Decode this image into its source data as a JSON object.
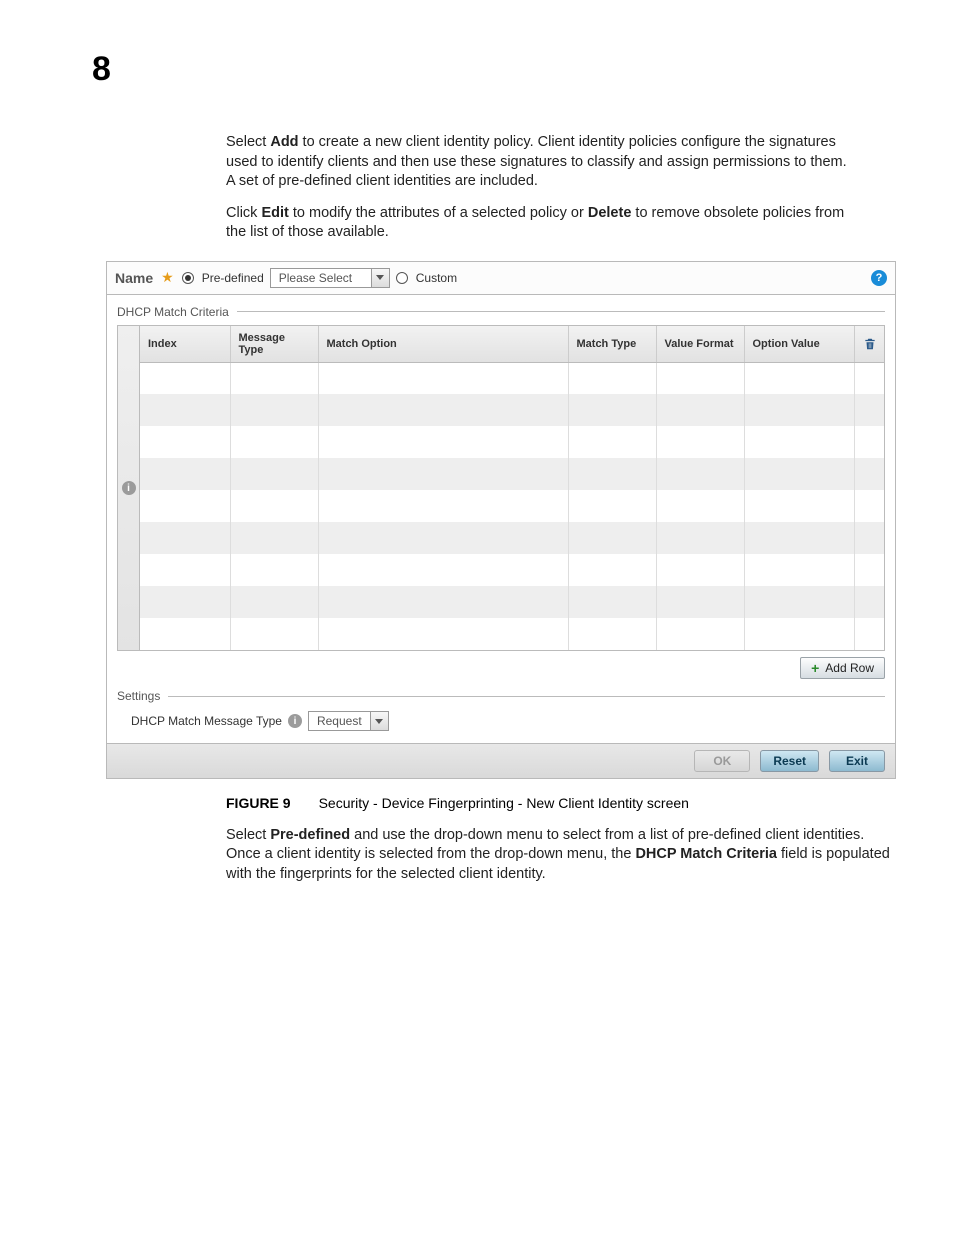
{
  "page": {
    "chapter_number": "8"
  },
  "intro": {
    "p1_a": "Select ",
    "p1_bold1": "Add",
    "p1_b": " to create a new client identity policy. Client identity policies configure the signatures used to identify clients and then use these signatures to classify and assign permissions to them. A set of pre-defined client identities are included.",
    "p2_a": "Click ",
    "p2_bold1": "Edit",
    "p2_b": " to modify the attributes of a selected policy or ",
    "p2_bold2": "Delete",
    "p2_c": " to remove obsolete policies from the list of those available."
  },
  "panel": {
    "name_label": "Name",
    "radio_predefined": "Pre-defined",
    "select_placeholder": "Please Select",
    "radio_custom": "Custom",
    "help_symbol": "?",
    "criteria_title": "DHCP Match Criteria",
    "columns": {
      "index": "Index",
      "message_type": "Message Type",
      "match_option": "Match Option",
      "match_type": "Match Type",
      "value_format": "Value Format",
      "option_value": "Option Value"
    },
    "info_symbol": "i",
    "add_row": "Add Row",
    "settings_title": "Settings",
    "settings_label": "DHCP Match Message Type",
    "settings_value": "Request",
    "buttons": {
      "ok": "OK",
      "reset": "Reset",
      "exit": "Exit"
    }
  },
  "figure": {
    "label": "FIGURE 9",
    "caption": "Security - Device Fingerprinting - New Client Identity screen"
  },
  "after": {
    "p1_a": "Select ",
    "p1_bold1": "Pre-defined",
    "p1_b": " and use the drop-down menu to select from a list of pre-defined client identities. Once a client identity is selected from the drop-down menu, the ",
    "p1_bold2": "DHCP Match Criteria",
    "p1_c": " field is populated with the fingerprints for the selected client identity."
  }
}
